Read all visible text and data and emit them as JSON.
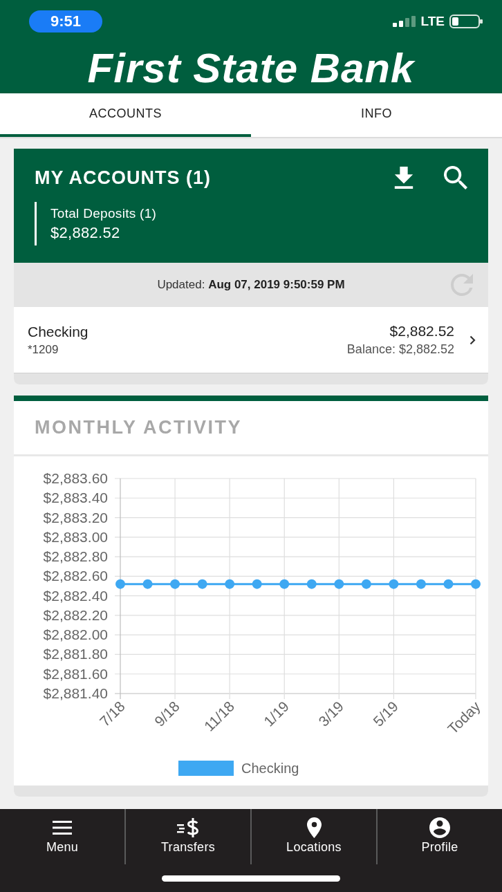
{
  "status_bar": {
    "time": "9:51",
    "network": "LTE"
  },
  "header": {
    "logo": "First State Bank"
  },
  "tabs": [
    {
      "label": "ACCOUNTS",
      "selected": true
    },
    {
      "label": "INFO",
      "selected": false
    }
  ],
  "accounts_card": {
    "title": "MY ACCOUNTS (1)",
    "total": {
      "label": "Total Deposits (1)",
      "amount": "$2,882.52"
    },
    "updated": "Updated: **Aug 07, 2019 9:50:59 PM**",
    "accounts": [
      {
        "name": "Checking",
        "number": "*1209",
        "amount": "$2,882.52",
        "balance": "Balance: $2,882.52"
      }
    ]
  },
  "activity_card": {
    "title": "MONTHLY ACTIVITY",
    "chart_data": {
      "type": "line",
      "grid": true,
      "categories": [
        "7/18",
        null,
        "9/18",
        null,
        "11/18",
        null,
        "1/19",
        null,
        "3/19",
        null,
        "5/19",
        null,
        null,
        "Today"
      ],
      "ylim": [
        2881.4,
        2883.6
      ],
      "yticks": [
        {
          "value": 2881.4,
          "label": "$2,881.40"
        },
        {
          "value": 2881.6,
          "label": "$2,881.60"
        },
        {
          "value": 2881.8,
          "label": "$2,881.80"
        },
        {
          "value": 2882.0,
          "label": "$2,882.00"
        },
        {
          "value": 2882.2,
          "label": "$2,882.20"
        },
        {
          "value": 2882.4,
          "label": "$2,882.40"
        },
        {
          "value": 2882.6,
          "label": "$2,882.60"
        },
        {
          "value": 2882.8,
          "label": "$2,882.80"
        },
        {
          "value": 2883.0,
          "label": "$2,883.00"
        },
        {
          "value": 2883.2,
          "label": "$2,883.20"
        },
        {
          "value": 2883.4,
          "label": "$2,883.40"
        },
        {
          "value": 2883.6,
          "label": "$2,883.60"
        }
      ],
      "series": [
        {
          "name": "Checking",
          "color": "#3ea8f2",
          "marker": "circle",
          "values": [
            2882.52,
            2882.52,
            2882.52,
            2882.52,
            2882.52,
            2882.52,
            2882.52,
            2882.52,
            2882.52,
            2882.52,
            2882.52,
            2882.52,
            2882.52,
            2882.52
          ]
        }
      ]
    }
  },
  "bottom_nav": [
    {
      "label": "Menu"
    },
    {
      "label": "Transfers"
    },
    {
      "label": "Locations"
    },
    {
      "label": "Profile"
    }
  ]
}
